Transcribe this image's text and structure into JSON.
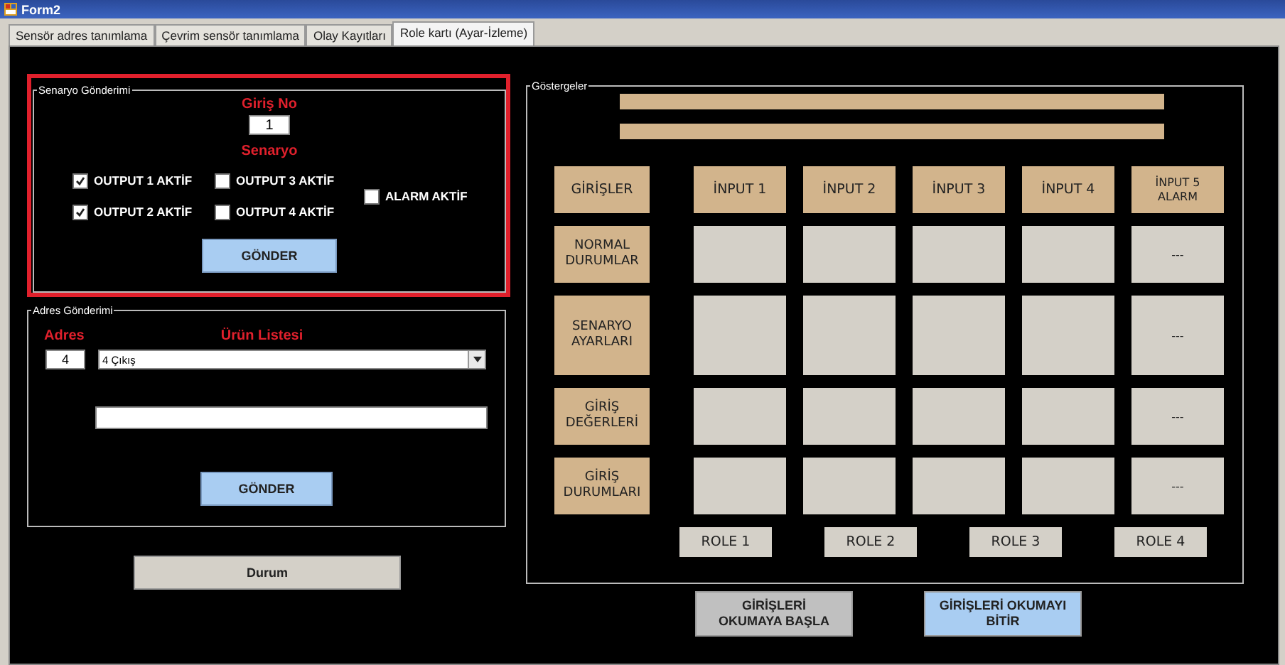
{
  "window": {
    "title": "Form2"
  },
  "tabs": [
    {
      "label": "Sensör adres tanımlama",
      "selected": false
    },
    {
      "label": "Çevrim sensör tanımlama",
      "selected": false
    },
    {
      "label": "Olay Kayıtları",
      "selected": false
    },
    {
      "label": "Role kartı (Ayar-İzleme)",
      "selected": true
    }
  ],
  "scenario_group": {
    "title": "Senaryo Gönderimi",
    "input_label": "Giriş No",
    "input_value": "1",
    "scenario_label": "Senaryo",
    "checkboxes": [
      {
        "label": "OUTPUT 1 AKTİF",
        "checked": true
      },
      {
        "label": "OUTPUT 2 AKTİF",
        "checked": true
      },
      {
        "label": "OUTPUT 3 AKTİF",
        "checked": false
      },
      {
        "label": "OUTPUT 4 AKTİF",
        "checked": false
      },
      {
        "label": "ALARM AKTİF",
        "checked": false
      }
    ],
    "button": "GÖNDER"
  },
  "address_group": {
    "title": "Adres Gönderimi",
    "address_label": "Adres",
    "address_value": "4",
    "product_label": "Ürün Listesi",
    "product_value": "4 Çıkış",
    "button": "GÖNDER"
  },
  "status_button": "Durum",
  "indicators": {
    "title": "Göstergeler",
    "columns": [
      "GİRİŞLER",
      "İNPUT 1",
      "İNPUT 2",
      "İNPUT 3",
      "İNPUT 4",
      "İNPUT 5\nALARM"
    ],
    "rows": [
      {
        "label": "NORMAL\nDURUMLAR",
        "alarm_value": "---"
      },
      {
        "label": "SENARYO\nAYARLARI",
        "alarm_value": "---"
      },
      {
        "label": "GİRİŞ\nDEĞERLERİ",
        "alarm_value": "---"
      },
      {
        "label": "GİRİŞ\nDURUMLARI",
        "alarm_value": "---"
      }
    ],
    "relays": [
      "ROLE 1",
      "ROLE 2",
      "ROLE 3",
      "ROLE 4"
    ]
  },
  "buttons": [
    {
      "label": "GİRİŞLERİ\nOKUMAYA BAŞLA",
      "kind": "grey"
    },
    {
      "label": "GİRİŞLERİ OKUMAYI\nBİTİR",
      "kind": "blue"
    }
  ]
}
